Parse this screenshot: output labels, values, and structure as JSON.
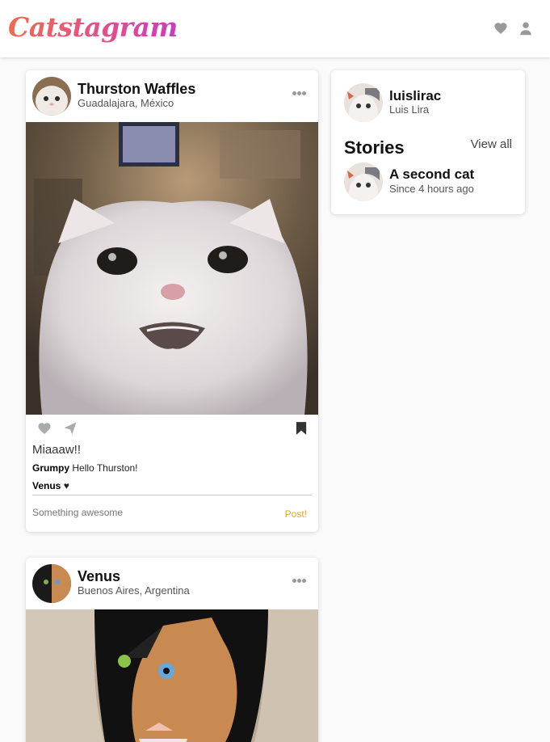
{
  "header": {
    "logo": "Catstagram",
    "icons": [
      "heart-icon",
      "user-icon"
    ]
  },
  "posts": [
    {
      "username": "Thurston Waffles",
      "location": "Guadalajara, México",
      "caption": "Miaaaw!!",
      "comments": [
        {
          "user": "Grumpy",
          "text": "Hello Thurston!"
        },
        {
          "user": "Venus",
          "text": "♥"
        }
      ],
      "comment_placeholder": "Something awesome",
      "post_label": "Post!"
    },
    {
      "username": "Venus",
      "location": "Buenos Aires, Argentina"
    }
  ],
  "sidebar": {
    "username": "luislirac",
    "name": "Luis Lira",
    "stories_title": "Stories",
    "view_all": "View all",
    "story": {
      "title": "A second cat",
      "time": "Since 4 hours ago"
    }
  },
  "colors": {
    "logo_gradient": [
      "#f06a4e",
      "#e4508a",
      "#c93cbf"
    ],
    "post_button": "#e3a23c",
    "background": "#fafafa"
  }
}
